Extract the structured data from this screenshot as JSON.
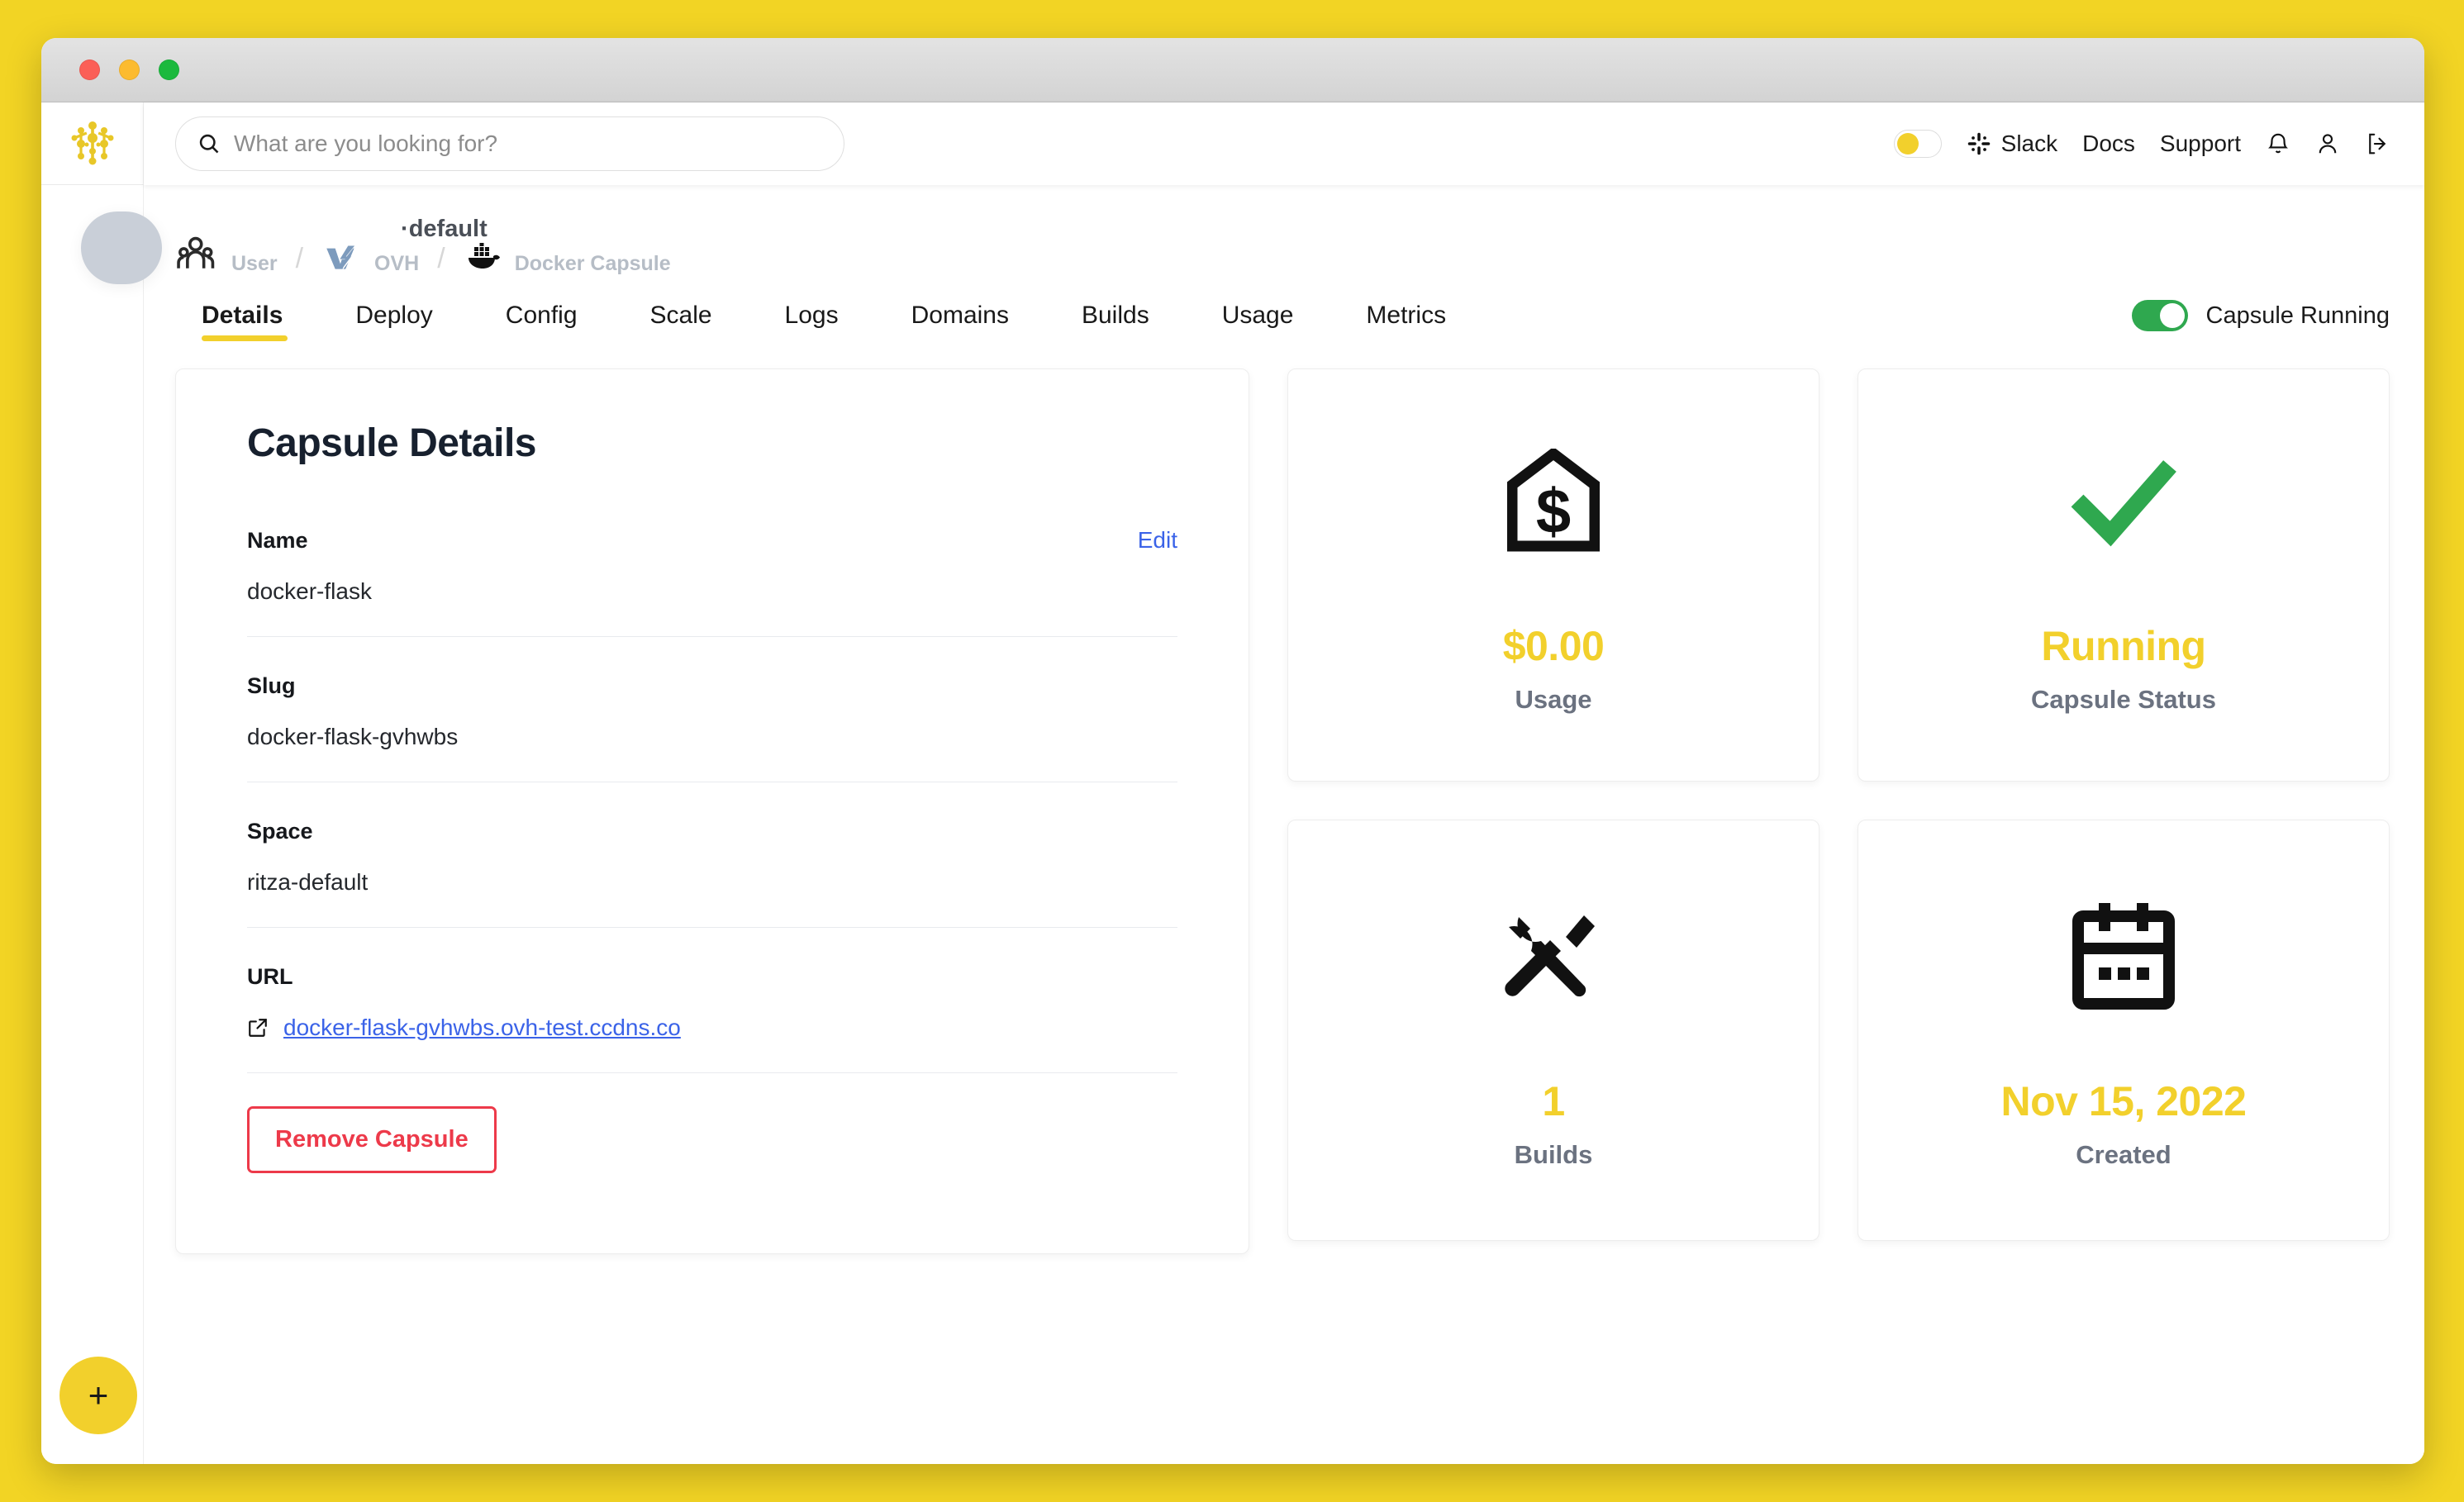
{
  "window": {
    "traffic_lights": [
      "close",
      "minimize",
      "zoom"
    ]
  },
  "sidebar": {
    "logo_name": "capsule-network-logo",
    "add_button_label": "+"
  },
  "topbar": {
    "search": {
      "placeholder": "What are you looking for?",
      "value": ""
    },
    "theme_toggle_on": true,
    "links": [
      {
        "label": "Slack",
        "icon": "slack-icon"
      },
      {
        "label": "Docs",
        "icon": null
      },
      {
        "label": "Support",
        "icon": null
      }
    ],
    "icons": [
      "bell-icon",
      "user-icon",
      "logout-icon"
    ]
  },
  "breadcrumb": {
    "items": [
      {
        "label": "User",
        "icon": "users-group-icon"
      },
      {
        "label": "OVH",
        "icon": "ovh-logo-icon",
        "overflow_text": "·default"
      },
      {
        "label": "Docker Capsule",
        "icon": "docker-whale-icon"
      }
    ],
    "separator": "/"
  },
  "tabs": [
    {
      "label": "Details",
      "active": true
    },
    {
      "label": "Deploy",
      "active": false
    },
    {
      "label": "Config",
      "active": false
    },
    {
      "label": "Scale",
      "active": false
    },
    {
      "label": "Logs",
      "active": false
    },
    {
      "label": "Domains",
      "active": false
    },
    {
      "label": "Builds",
      "active": false
    },
    {
      "label": "Usage",
      "active": false
    },
    {
      "label": "Metrics",
      "active": false
    }
  ],
  "capsule_toggle": {
    "label": "Capsule Running",
    "on": true
  },
  "details_card": {
    "title": "Capsule Details",
    "edit_label": "Edit",
    "fields": [
      {
        "label": "Name",
        "value": "docker-flask"
      },
      {
        "label": "Slug",
        "value": "docker-flask-gvhwbs"
      },
      {
        "label": "Space",
        "value": "ritza-default"
      },
      {
        "label": "URL",
        "value": "docker-flask-gvhwbs.ovh-test.ccdns.co"
      }
    ],
    "remove_label": "Remove Capsule"
  },
  "stats": [
    {
      "icon": "price-tag-dollar-icon",
      "value": "$0.00",
      "label": "Usage"
    },
    {
      "icon": "checkmark-icon",
      "value": "Running",
      "label": "Capsule Status"
    },
    {
      "icon": "tools-icon",
      "value": "1",
      "label": "Builds"
    },
    {
      "icon": "calendar-icon",
      "value": "Nov 15, 2022",
      "label": "Created"
    }
  ],
  "colors": {
    "brand_yellow": "#F2D424",
    "accent_yellow": "#F2D02C",
    "link_blue": "#3B63E8",
    "danger_red": "#ED3A4A",
    "success_green": "#2FA84F",
    "muted_gray": "#6b7280"
  }
}
